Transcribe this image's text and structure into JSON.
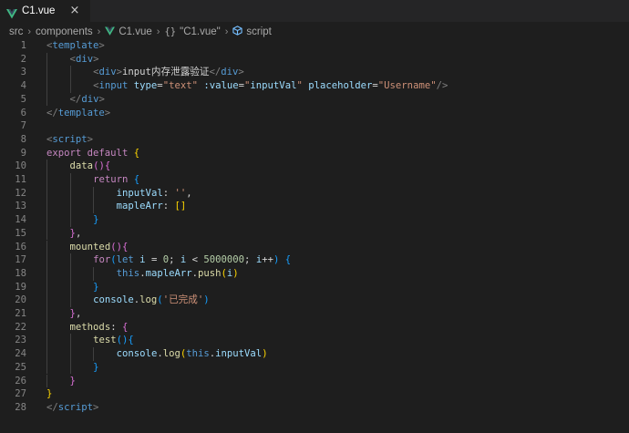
{
  "tab": {
    "label": "C1.vue",
    "close_glyph": "×",
    "icon": "vue-logo-icon"
  },
  "breadcrumb": {
    "items": [
      "src",
      "components",
      "C1.vue",
      "\"C1.vue\"",
      "script"
    ],
    "separator": "›"
  },
  "colors": {
    "background": "#1e1e1e",
    "tabbar": "#252526",
    "vue_green": "#41b883",
    "keyword": "#c586c0",
    "tag": "#569cd6",
    "attribute": "#9cdcfe",
    "string": "#ce9178",
    "function": "#dcdcaa",
    "number": "#b5cea8"
  },
  "editor": {
    "lines": [
      {
        "n": "1",
        "indent": 0,
        "tokens": [
          [
            "tag",
            "<"
          ],
          [
            "name",
            "template"
          ],
          [
            "tag",
            ">"
          ]
        ]
      },
      {
        "n": "2",
        "indent": 1,
        "tokens": [
          [
            "tag",
            "<"
          ],
          [
            "name",
            "div"
          ],
          [
            "tag",
            ">"
          ]
        ]
      },
      {
        "n": "3",
        "indent": 2,
        "tokens": [
          [
            "tag",
            "<"
          ],
          [
            "name",
            "div"
          ],
          [
            "tag",
            ">"
          ],
          [
            "txt",
            "input内存泄露验证"
          ],
          [
            "tag",
            "</"
          ],
          [
            "name",
            "div"
          ],
          [
            "tag",
            ">"
          ]
        ]
      },
      {
        "n": "4",
        "indent": 2,
        "tokens": [
          [
            "tag",
            "<"
          ],
          [
            "name",
            "input"
          ],
          [
            "txt",
            " "
          ],
          [
            "attr",
            "type"
          ],
          [
            "txt",
            "="
          ],
          [
            "str",
            "\"text\""
          ],
          [
            "txt",
            " "
          ],
          [
            "attr",
            ":value"
          ],
          [
            "txt",
            "="
          ],
          [
            "str",
            "\""
          ],
          [
            "var",
            "inputVal"
          ],
          [
            "str",
            "\""
          ],
          [
            "txt",
            " "
          ],
          [
            "attr",
            "placeholder"
          ],
          [
            "txt",
            "="
          ],
          [
            "str",
            "\"Username\""
          ],
          [
            "tag",
            "/>"
          ]
        ]
      },
      {
        "n": "5",
        "indent": 1,
        "tokens": [
          [
            "tag",
            "</"
          ],
          [
            "name",
            "div"
          ],
          [
            "tag",
            ">"
          ]
        ]
      },
      {
        "n": "6",
        "indent": 0,
        "tokens": [
          [
            "tag",
            "</"
          ],
          [
            "name",
            "template"
          ],
          [
            "tag",
            ">"
          ]
        ]
      },
      {
        "n": "7",
        "indent": 0,
        "tokens": []
      },
      {
        "n": "8",
        "indent": 0,
        "tokens": [
          [
            "tag",
            "<"
          ],
          [
            "name",
            "script"
          ],
          [
            "tag",
            ">"
          ]
        ]
      },
      {
        "n": "9",
        "indent": 0,
        "tokens": [
          [
            "kw",
            "export"
          ],
          [
            "txt",
            " "
          ],
          [
            "kw",
            "default"
          ],
          [
            "txt",
            " "
          ],
          [
            "p1",
            "{"
          ]
        ]
      },
      {
        "n": "10",
        "indent": 1,
        "tokens": [
          [
            "fn",
            "data"
          ],
          [
            "p2",
            "()"
          ],
          [
            "p2",
            "{"
          ]
        ]
      },
      {
        "n": "11",
        "indent": 2,
        "tokens": [
          [
            "kw",
            "return"
          ],
          [
            "txt",
            " "
          ],
          [
            "p3",
            "{"
          ]
        ]
      },
      {
        "n": "12",
        "indent": 3,
        "tokens": [
          [
            "var",
            "inputVal"
          ],
          [
            "txt",
            ": "
          ],
          [
            "str",
            "''"
          ],
          [
            "txt",
            ","
          ]
        ]
      },
      {
        "n": "13",
        "indent": 3,
        "tokens": [
          [
            "var",
            "mapleArr"
          ],
          [
            "txt",
            ": "
          ],
          [
            "p1",
            "[]"
          ]
        ]
      },
      {
        "n": "14",
        "indent": 2,
        "tokens": [
          [
            "p3",
            "}"
          ]
        ]
      },
      {
        "n": "15",
        "indent": 1,
        "tokens": [
          [
            "p2",
            "}"
          ],
          [
            "txt",
            ","
          ]
        ]
      },
      {
        "n": "16",
        "indent": 1,
        "tokens": [
          [
            "fn",
            "mounted"
          ],
          [
            "p2",
            "()"
          ],
          [
            "p2",
            "{"
          ]
        ]
      },
      {
        "n": "17",
        "indent": 2,
        "tokens": [
          [
            "kw",
            "for"
          ],
          [
            "p3",
            "("
          ],
          [
            "name",
            "let"
          ],
          [
            "txt",
            " "
          ],
          [
            "var",
            "i"
          ],
          [
            "txt",
            " = "
          ],
          [
            "num",
            "0"
          ],
          [
            "txt",
            "; "
          ],
          [
            "var",
            "i"
          ],
          [
            "txt",
            " < "
          ],
          [
            "num",
            "5000000"
          ],
          [
            "txt",
            "; "
          ],
          [
            "var",
            "i"
          ],
          [
            "txt",
            "++"
          ],
          [
            "p3",
            ")"
          ],
          [
            "txt",
            " "
          ],
          [
            "p3",
            "{"
          ]
        ]
      },
      {
        "n": "18",
        "indent": 3,
        "tokens": [
          [
            "this",
            "this"
          ],
          [
            "txt",
            "."
          ],
          [
            "var",
            "mapleArr"
          ],
          [
            "txt",
            "."
          ],
          [
            "fn",
            "push"
          ],
          [
            "p1",
            "("
          ],
          [
            "var",
            "i"
          ],
          [
            "p1",
            ")"
          ]
        ]
      },
      {
        "n": "19",
        "indent": 2,
        "tokens": [
          [
            "p3",
            "}"
          ]
        ]
      },
      {
        "n": "20",
        "indent": 2,
        "tokens": [
          [
            "var",
            "console"
          ],
          [
            "txt",
            "."
          ],
          [
            "fn",
            "log"
          ],
          [
            "p3",
            "("
          ],
          [
            "str",
            "'已完成'"
          ],
          [
            "p3",
            ")"
          ]
        ]
      },
      {
        "n": "21",
        "indent": 1,
        "tokens": [
          [
            "p2",
            "}"
          ],
          [
            "txt",
            ","
          ]
        ]
      },
      {
        "n": "22",
        "indent": 1,
        "tokens": [
          [
            "fn",
            "methods"
          ],
          [
            "txt",
            ": "
          ],
          [
            "p2",
            "{"
          ]
        ]
      },
      {
        "n": "23",
        "indent": 2,
        "tokens": [
          [
            "fn",
            "test"
          ],
          [
            "p3",
            "()"
          ],
          [
            "p3",
            "{"
          ]
        ]
      },
      {
        "n": "24",
        "indent": 3,
        "tokens": [
          [
            "var",
            "console"
          ],
          [
            "txt",
            "."
          ],
          [
            "fn",
            "log"
          ],
          [
            "p1",
            "("
          ],
          [
            "this",
            "this"
          ],
          [
            "txt",
            "."
          ],
          [
            "var",
            "inputVal"
          ],
          [
            "p1",
            ")"
          ]
        ]
      },
      {
        "n": "25",
        "indent": 2,
        "tokens": [
          [
            "p3",
            "}"
          ]
        ]
      },
      {
        "n": "26",
        "indent": 1,
        "tokens": [
          [
            "p2",
            "}"
          ]
        ]
      },
      {
        "n": "27",
        "indent": 0,
        "tokens": [
          [
            "p1",
            "}"
          ]
        ]
      },
      {
        "n": "28",
        "indent": 0,
        "tokens": [
          [
            "tag",
            "</"
          ],
          [
            "name",
            "script"
          ],
          [
            "tag",
            ">"
          ]
        ]
      }
    ]
  }
}
